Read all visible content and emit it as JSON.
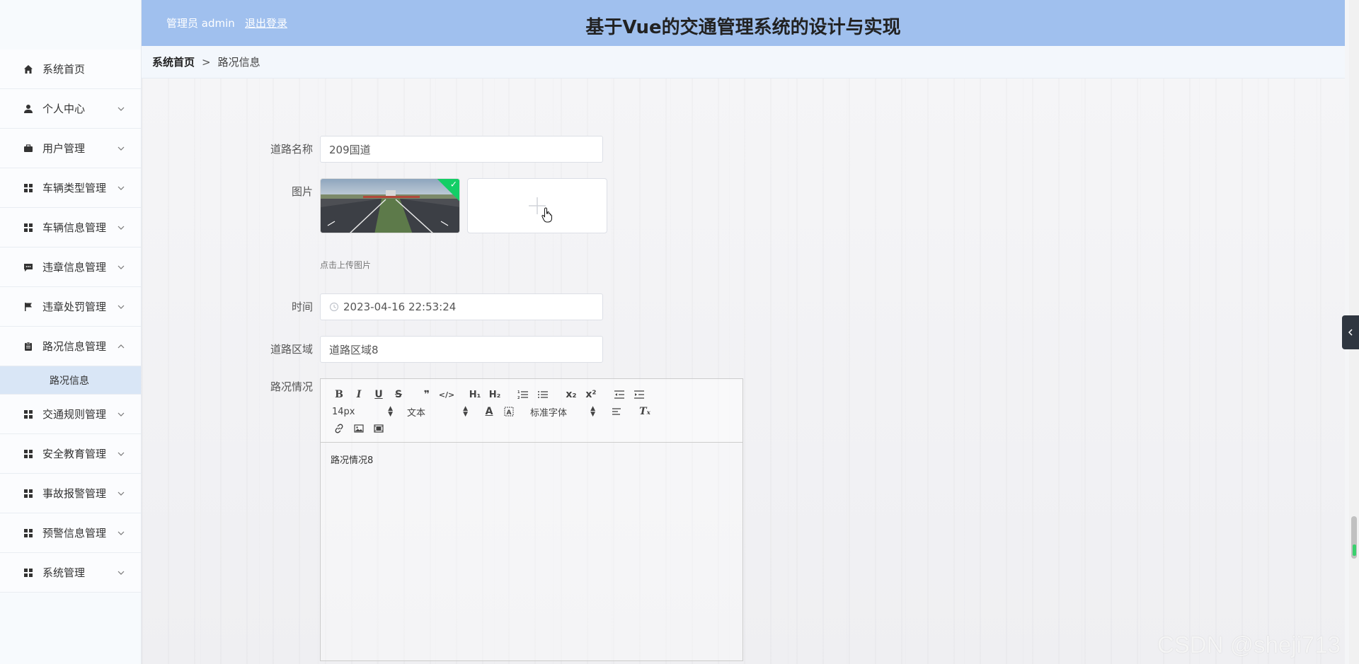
{
  "header": {
    "admin_label": "管理员 admin",
    "logout_label": "退出登录",
    "title": "基于Vue的交通管理系统的设计与实现"
  },
  "breadcrumb": {
    "home": "系统首页",
    "separator": ">",
    "current": "路况信息"
  },
  "sidebar": {
    "items": [
      {
        "label": "系统首页",
        "icon": "home-icon",
        "has_chevron": false
      },
      {
        "label": "个人中心",
        "icon": "user-icon",
        "has_chevron": true
      },
      {
        "label": "用户管理",
        "icon": "briefcase-icon",
        "has_chevron": true
      },
      {
        "label": "车辆类型管理",
        "icon": "grid-icon",
        "has_chevron": true
      },
      {
        "label": "车辆信息管理",
        "icon": "grid-icon",
        "has_chevron": true
      },
      {
        "label": "违章信息管理",
        "icon": "chat-icon",
        "has_chevron": true
      },
      {
        "label": "违章处罚管理",
        "icon": "flag-icon",
        "has_chevron": true
      },
      {
        "label": "路况信息管理",
        "icon": "clipboard-icon",
        "has_chevron": true,
        "expanded": true
      },
      {
        "label": "交通规则管理",
        "icon": "grid-icon",
        "has_chevron": true
      },
      {
        "label": "安全教育管理",
        "icon": "grid-icon",
        "has_chevron": true
      },
      {
        "label": "事故报警管理",
        "icon": "grid-icon",
        "has_chevron": true
      },
      {
        "label": "预警信息管理",
        "icon": "grid-icon",
        "has_chevron": true
      },
      {
        "label": "系统管理",
        "icon": "grid-icon",
        "has_chevron": true
      }
    ],
    "submenu": {
      "label": "路况信息"
    }
  },
  "form": {
    "road_name": {
      "label": "道路名称",
      "value": "209国道"
    },
    "image": {
      "label": "图片",
      "tip": "点击上传图片"
    },
    "time": {
      "label": "时间",
      "value": "2023-04-16 22:53:24"
    },
    "road_area": {
      "label": "道路区域",
      "value": "道路区域8"
    },
    "condition": {
      "label": "路况情况",
      "content": "路况情况8"
    }
  },
  "editor": {
    "font_size": "14px",
    "text_type": "文本",
    "font_family": "标准字体"
  },
  "colors": {
    "header_bg": "#a0c0ee",
    "submenu_active_bg": "#d9e6f6",
    "upload_success": "#13ce66"
  },
  "watermark": "CSDN @sheji713"
}
